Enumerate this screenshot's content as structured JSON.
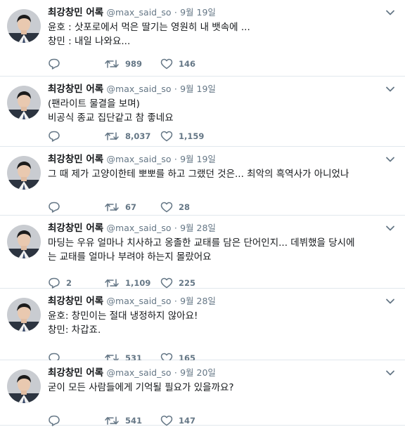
{
  "tweets": [
    {
      "name": "최강창민 어록",
      "handle": "@max_said_so",
      "dot": "·",
      "time": "9월 19일",
      "lines": [
        "윤호 : 삿포로에서 먹은 딸기는 영원히 내 뱃속에 ...",
        "창민 : 내일 나와요..."
      ],
      "replies": "",
      "retweets": "989",
      "likes": "146"
    },
    {
      "name": "최강창민 어록",
      "handle": "@max_said_so",
      "dot": "·",
      "time": "9월 19일",
      "lines": [
        "(팬라이트 물결을 보며)",
        "비공식 종교 집단같고 참 좋네요"
      ],
      "replies": "",
      "retweets": "8,037",
      "likes": "1,159"
    },
    {
      "name": "최강창민 어록",
      "handle": "@max_said_so",
      "dot": "·",
      "time": "9월 19일",
      "lines": [
        "그 때 제가 고양이한테 뽀뽀를 하고 그랬던 것은... 최악의 흑역사가 아니었나"
      ],
      "replies": "",
      "retweets": "67",
      "likes": "28"
    },
    {
      "name": "최강창민 어록",
      "handle": "@max_said_so",
      "dot": "·",
      "time": "9월 28일",
      "lines": [
        "마딩는 우유 얼마나 치사하고 옹졸한 교태를 담은 단어인지... 데뷔했을 당시에",
        "는 교태를 얼마나 부려야 하는지 몰랐어요"
      ],
      "replies": "2",
      "retweets": "1,109",
      "likes": "225"
    },
    {
      "name": "최강창민 어록",
      "handle": "@max_said_so",
      "dot": "·",
      "time": "9월 28일",
      "lines": [
        "윤호: 창민이는 절대 냉정하지 않아요!",
        "창민: 차갑죠."
      ],
      "replies": "",
      "retweets": "531",
      "likes": "165"
    },
    {
      "name": "최강창민 어록",
      "handle": "@max_said_so",
      "dot": "·",
      "time": "9월 20일",
      "lines": [
        "굳이 모든 사람들에게 기억될 필요가 있을까요?"
      ],
      "replies": "",
      "retweets": "541",
      "likes": "147"
    }
  ],
  "colors": {
    "text": "#14171a",
    "muted": "#657786",
    "divider": "#e1e8ed"
  },
  "icons": {
    "reply": "reply-icon",
    "retweet": "retweet-icon",
    "like": "heart-icon",
    "caret": "chevron-down-icon",
    "avatar": "avatar"
  }
}
